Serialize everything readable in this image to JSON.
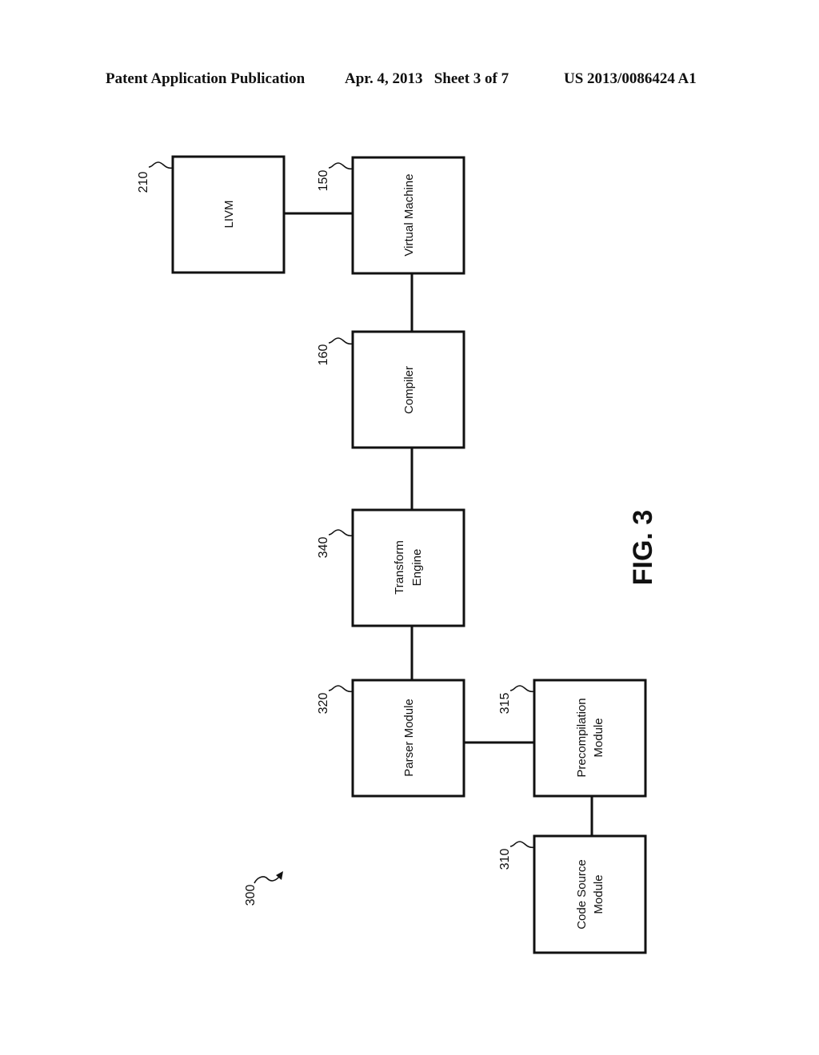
{
  "header": {
    "publication": "Patent Application Publication",
    "date_sheet": "Apr. 4, 2013   Sheet 3 of 7",
    "number": "US 2013/0086424 A1"
  },
  "figure": {
    "label": "FIG. 3",
    "system_ref": "300"
  },
  "blocks": {
    "livm": {
      "ref": "210",
      "lines": [
        "LIVM"
      ]
    },
    "virtual_machine": {
      "ref": "150",
      "lines": [
        "Virtual Machine"
      ]
    },
    "compiler": {
      "ref": "160",
      "lines": [
        "Compiler"
      ]
    },
    "transform_engine": {
      "ref": "340",
      "lines": [
        "Transform",
        "Engine"
      ]
    },
    "parser_module": {
      "ref": "320",
      "lines": [
        "Parser Module"
      ]
    },
    "precompilation_module": {
      "ref": "315",
      "lines": [
        "Precompilation",
        "Module"
      ]
    },
    "code_source_module": {
      "ref": "310",
      "lines": [
        "Code Source",
        "Module"
      ]
    }
  },
  "connections": [
    [
      "livm",
      "virtual_machine"
    ],
    [
      "virtual_machine",
      "compiler"
    ],
    [
      "compiler",
      "transform_engine"
    ],
    [
      "transform_engine",
      "parser_module"
    ],
    [
      "parser_module",
      "precompilation_module"
    ],
    [
      "precompilation_module",
      "code_source_module"
    ]
  ]
}
